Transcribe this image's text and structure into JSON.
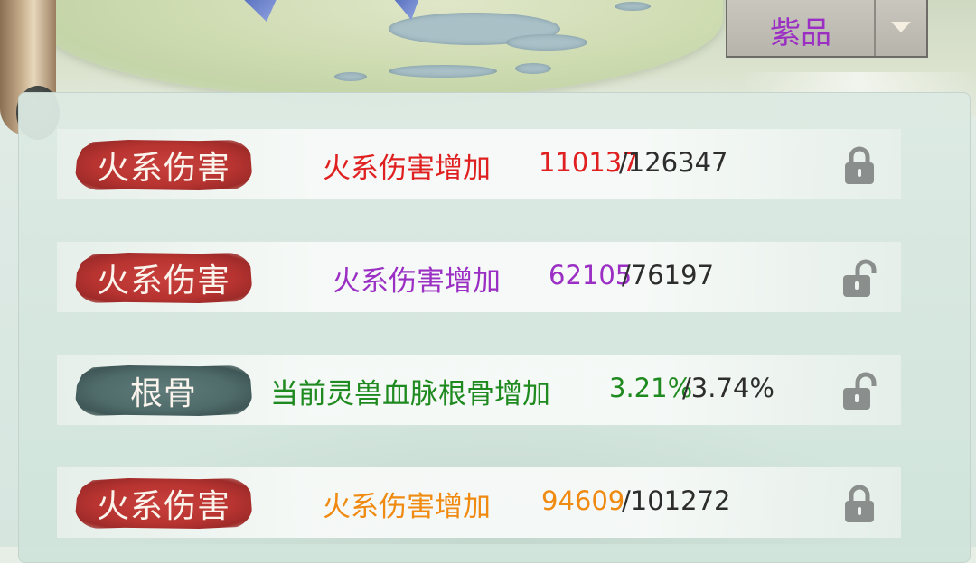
{
  "colors": {
    "red": "#e02020",
    "purple": "#9b2fc4",
    "green": "#1f8a1f",
    "orange": "#f08a10",
    "dark": "#2d2d2d"
  },
  "quality_dropdown": {
    "value": "紫品"
  },
  "rows": [
    {
      "tag": "火系伤害",
      "tag_style": "fire",
      "desc": "火系伤害增加",
      "current": "110137",
      "max": "/126347",
      "color": "#e02020",
      "lock": "locked"
    },
    {
      "tag": "火系伤害",
      "tag_style": "fire",
      "desc": "火系伤害增加",
      "current": "62105",
      "max": "/76197",
      "color": "#9b2fc4",
      "lock": "unlocked"
    },
    {
      "tag": "根骨",
      "tag_style": "bone",
      "desc": "当前灵兽血脉根骨增加",
      "current": "3.21%",
      "max": "/3.74%",
      "color": "#1f8a1f",
      "lock": "unlocked"
    },
    {
      "tag": "火系伤害",
      "tag_style": "fire",
      "desc": "火系伤害增加",
      "current": "94609",
      "max": "/101272",
      "color": "#f08a10",
      "lock": "locked"
    }
  ]
}
